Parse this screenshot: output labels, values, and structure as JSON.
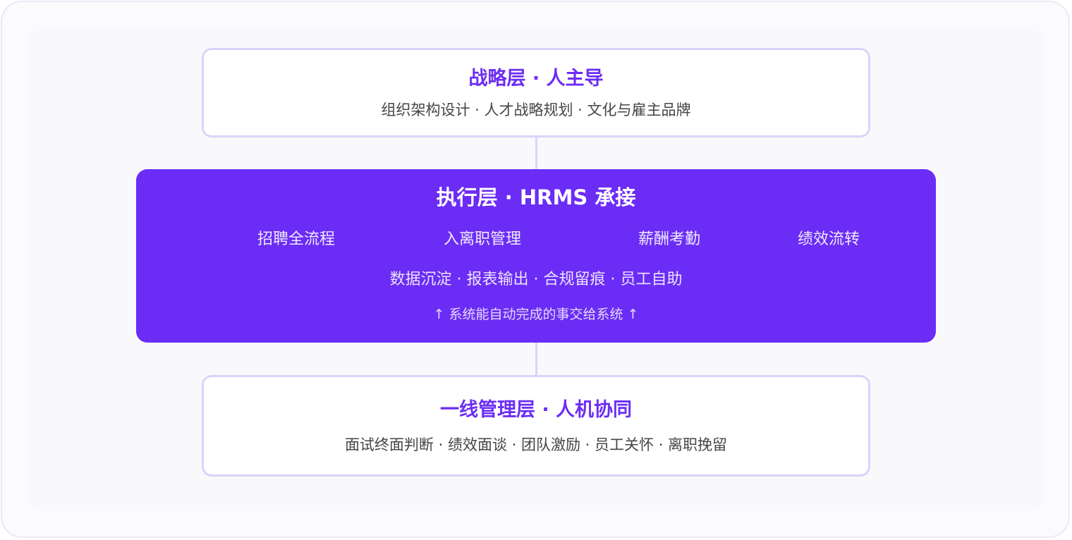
{
  "strategy_layer": {
    "title": "战略层 · 人主导",
    "subtitle": "组织架构设计 · 人才战略规划 · 文化与雇主品牌"
  },
  "execution_layer": {
    "title": "执行层 · HRMS 承接",
    "modules": [
      "招聘全流程",
      "入离职管理",
      "薪酬考勤",
      "绩效流转"
    ],
    "subtitle": "数据沉淀 · 报表输出 · 合规留痕 · 员工自助",
    "note": "↑ 系统能自动完成的事交给系统 ↑"
  },
  "frontline_layer": {
    "title": "一线管理层 · 人机协同",
    "subtitle": "面试终面判断 · 绩效面谈 · 团队激励 · 员工关怀 · 离职挽留"
  },
  "colors": {
    "accent": "#6b2cf5",
    "card_border": "#dcd3fb",
    "body_text": "#454545"
  }
}
